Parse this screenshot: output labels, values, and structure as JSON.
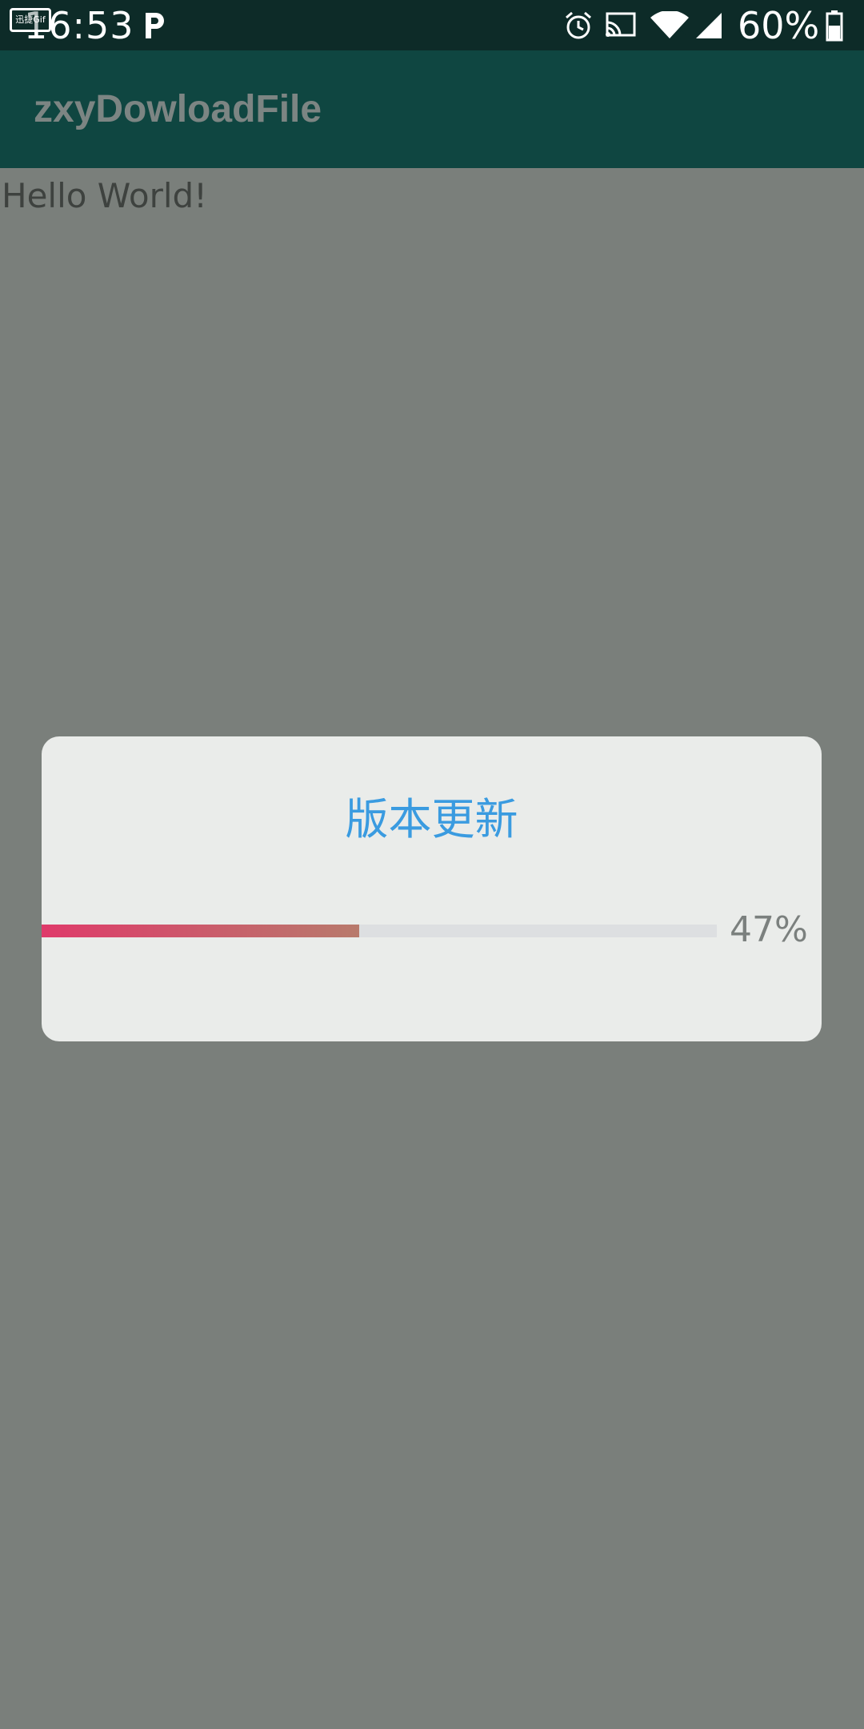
{
  "status_bar": {
    "time": "16:53",
    "gif_badge": "迅捷Gif",
    "battery": "60%",
    "icons": [
      "p-icon",
      "alarm-icon",
      "cast-icon",
      "wifi-icon",
      "signal-icon",
      "battery-icon"
    ]
  },
  "app_bar": {
    "title": "zxyDowloadFile"
  },
  "content": {
    "hello_text": "Hello World!"
  },
  "dialog": {
    "title": "版本更新",
    "progress_percent": "47%",
    "progress_value": 0.47
  },
  "colors": {
    "status_bar_bg": "#0d2b28",
    "app_bar_bg": "#0f4641",
    "scrim_bg": "#7a7f7b",
    "dialog_bg": "#eaecea",
    "dialog_title": "#3a9be0",
    "progress_fill_start": "#df3a6a",
    "progress_fill_end": "#b87a6c",
    "progress_track": "#dddfe1"
  }
}
